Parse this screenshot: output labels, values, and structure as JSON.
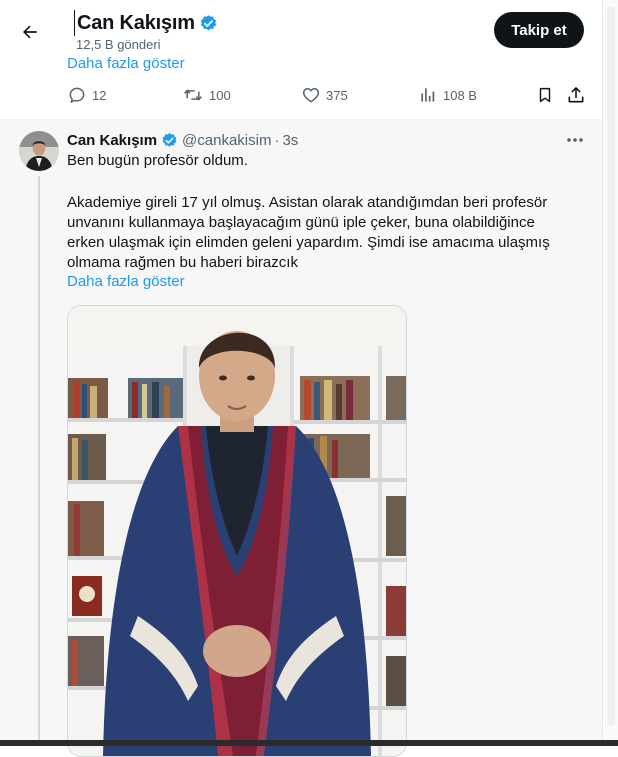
{
  "header": {
    "name": "Can Kakışım",
    "post_count": "12,5 B gönderi",
    "follow_label": "Takip et",
    "show_more": "Daha fazla göster"
  },
  "actions": {
    "replies": "12",
    "reposts": "100",
    "likes": "375",
    "views": "108 B"
  },
  "tweet": {
    "name": "Can Kakışım",
    "handle": "@cankakisim",
    "separator": "·",
    "time": "3s",
    "lines": [
      "Ben bugün profesör oldum.",
      "Akademiye gireli 17 yıl olmuş. Asistan olarak atandığımdan beri profesör",
      "unvanını kullanmaya başlayacağım günü iple çeker, buna olabildiğince",
      "erken ulaşmak için elimden geleni yapardım. Şimdi ise amacıma ulaşmış",
      "olmama rağmen bu haberi birazcık"
    ],
    "show_more": "Daha fazla göster"
  },
  "colors": {
    "accent": "#1d9bf0",
    "text": "#0f1419",
    "muted": "#536471",
    "follow_bg": "#0f1419"
  }
}
